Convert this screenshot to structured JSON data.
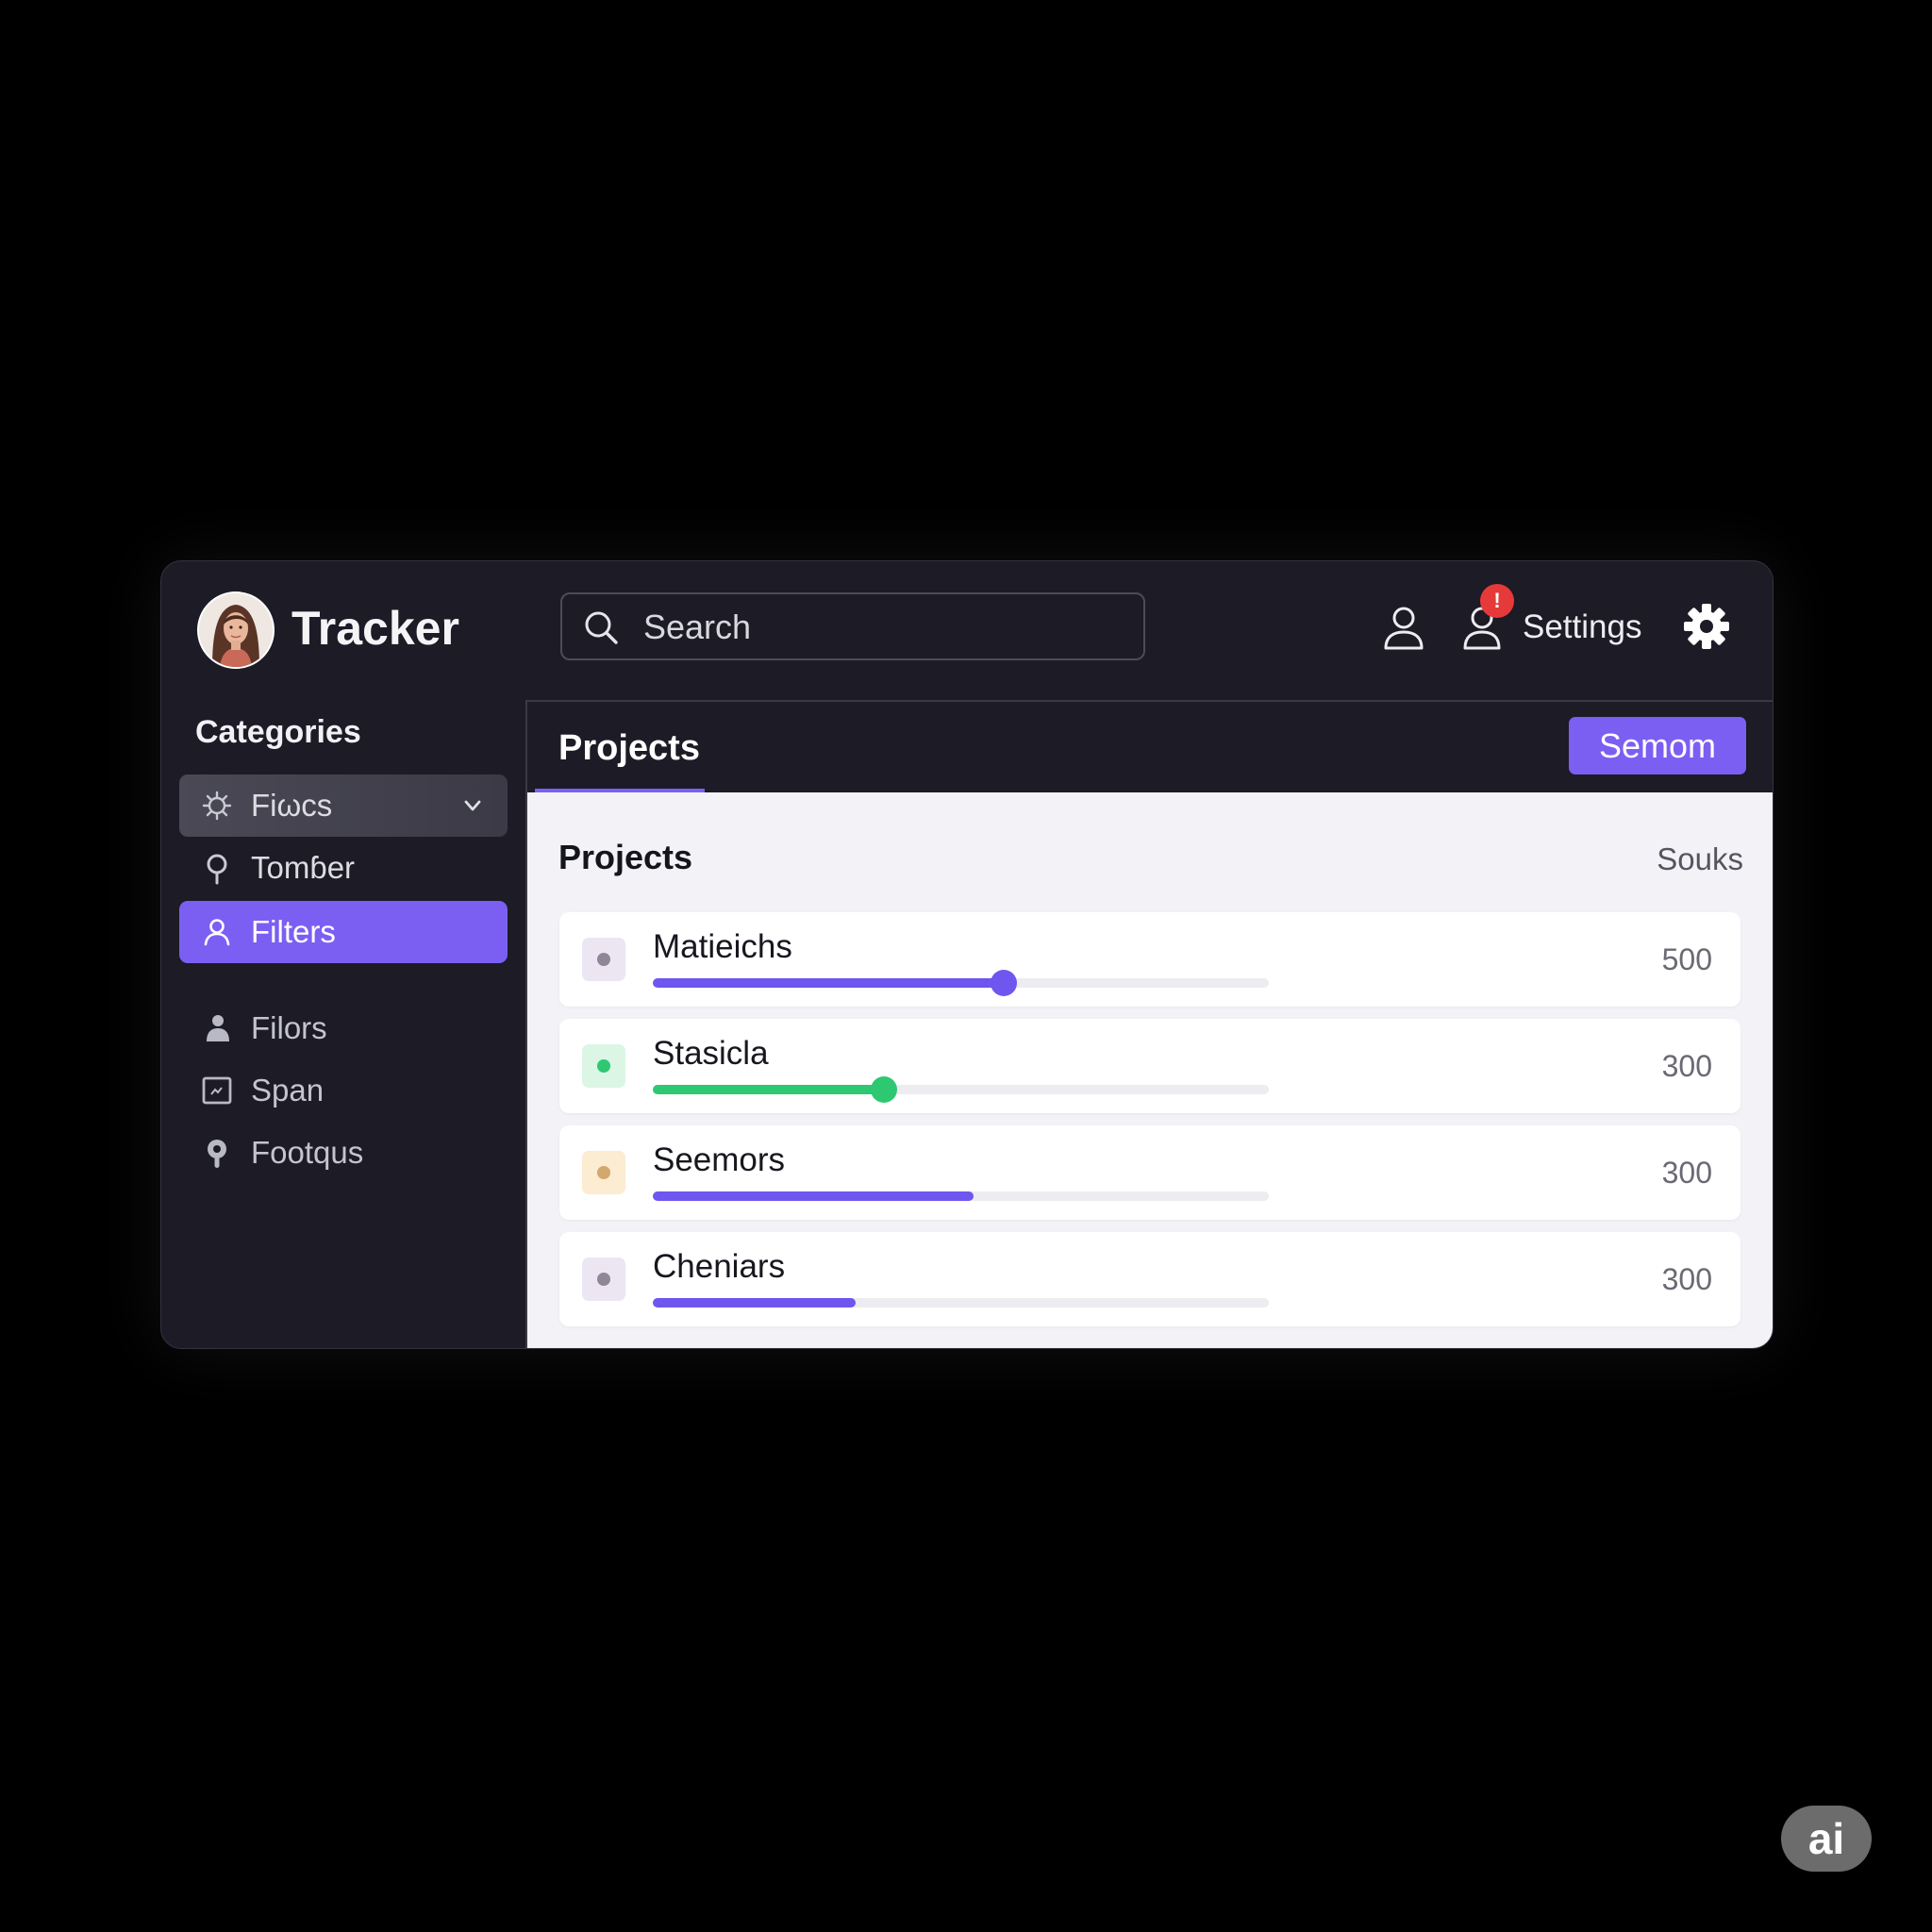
{
  "header": {
    "app_title": "Tracker",
    "search_placeholder": "Search",
    "notification_badge": "!",
    "settings_label": "Settings"
  },
  "sidebar": {
    "title": "Categories",
    "items": [
      {
        "label": "Fiωcs",
        "icon": "gear-outline-icon",
        "state": "expanded"
      },
      {
        "label": "Tomɓer",
        "icon": "pin-icon",
        "state": "normal"
      },
      {
        "label": "Filters",
        "icon": "user-icon",
        "state": "active"
      },
      {
        "label": "Filors",
        "icon": "users-icon",
        "state": "muted"
      },
      {
        "label": "Span",
        "icon": "image-icon",
        "state": "muted"
      },
      {
        "label": "Footqus",
        "icon": "location-pin-icon",
        "state": "muted"
      }
    ]
  },
  "main": {
    "tab_label": "Projects",
    "primary_button_label": "Semom",
    "content_title": "Projects",
    "content_right_label": "Souks",
    "rows": [
      {
        "label": "Matieichs",
        "value": "500",
        "progress": 0.57,
        "color": "#6e56ee",
        "dot_bg": "#ece6f2",
        "dot_color": "#8f8797",
        "knob": true
      },
      {
        "label": "Stasicla",
        "value": "300",
        "progress": 0.375,
        "color": "#2ec872",
        "dot_bg": "#dcf6e6",
        "dot_color": "#2ec872",
        "knob": true
      },
      {
        "label": "Seemors",
        "value": "300",
        "progress": 0.52,
        "color": "#6e56ee",
        "dot_bg": "#fbecd2",
        "dot_color": "#d2a86e",
        "knob": false
      },
      {
        "label": "Cheniars",
        "value": "300",
        "progress": 0.33,
        "color": "#6e56ee",
        "dot_bg": "#ece6f2",
        "dot_color": "#8f8797",
        "knob": false
      }
    ]
  },
  "colors": {
    "accent": "#7b5ff2",
    "panel_bg": "#1c1b26",
    "content_bg": "#f3f3f7",
    "badge": "#e63a3a"
  },
  "watermark": "ai"
}
